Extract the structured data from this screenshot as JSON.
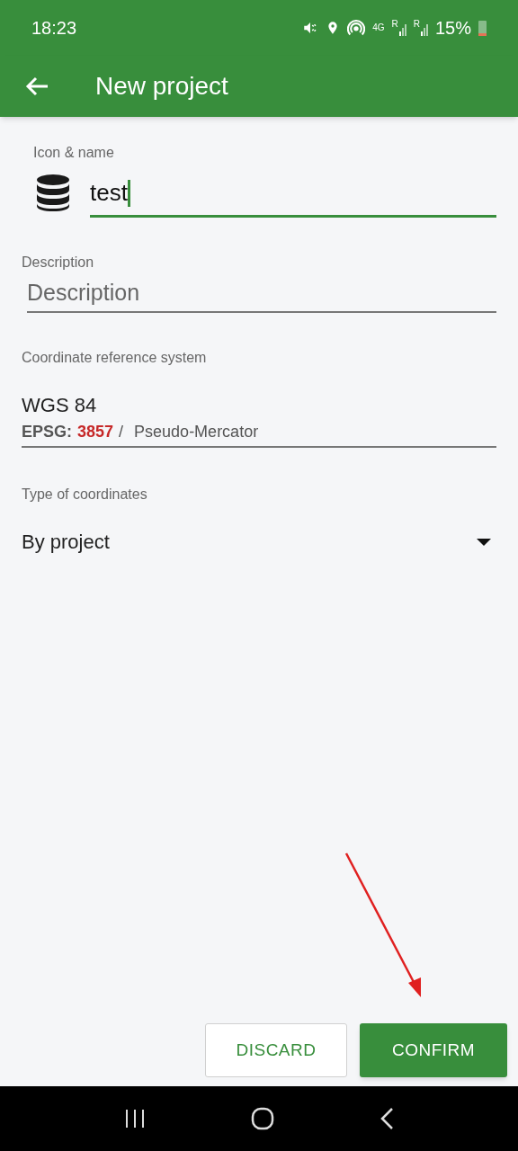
{
  "status_bar": {
    "time": "18:23",
    "network": "4G",
    "roaming": [
      "R",
      "R"
    ],
    "battery": "15%"
  },
  "app_bar": {
    "title": "New project"
  },
  "form": {
    "icon_name": {
      "label": "Icon & name",
      "value": "test",
      "focused": true
    },
    "description": {
      "label": "Description",
      "placeholder": "Description"
    },
    "crs": {
      "label": "Coordinate reference system",
      "name": "WGS 84",
      "code_label": "EPSG:",
      "code": "3857",
      "separator": "/",
      "projection": "Pseudo-Mercator"
    },
    "coordinate_type": {
      "label": "Type of coordinates",
      "value": "By project"
    }
  },
  "buttons": [
    {
      "label": "DISCARD",
      "kind": "outlined"
    },
    {
      "label": "CONFIRM",
      "kind": "filled"
    }
  ]
}
